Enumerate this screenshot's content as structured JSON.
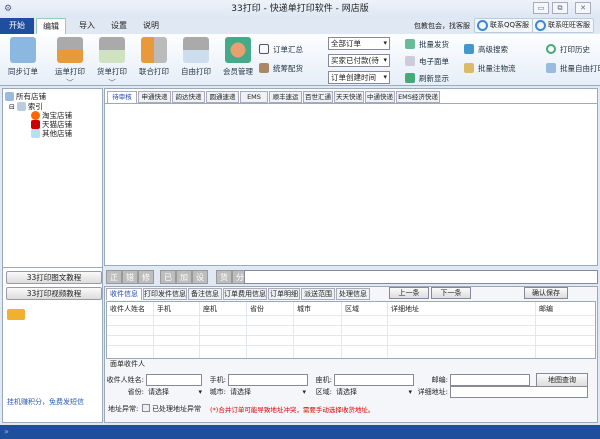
{
  "window": {
    "title": "33打印 - 快递单打印软件 - 网店版",
    "min": "▭",
    "max": "⧉",
    "close": "✕"
  },
  "menu": {
    "start": "开始",
    "tabs": [
      "编辑",
      "导入",
      "设置",
      "说明"
    ],
    "promo": "包教包会，找客服",
    "qq": "联系QQ客服",
    "wangwang": "联系旺旺客服"
  },
  "ribbon": {
    "big": [
      "同步订单",
      "运单打印",
      "货单打印",
      "联合打印",
      "自由打印",
      "会员管理"
    ],
    "small1": [
      "订单汇总",
      "统筹配货"
    ],
    "selects": [
      "全部订单",
      "买家已付款(待",
      "订单创建时间"
    ],
    "small2": [
      "批量发货",
      "电子面单",
      "刷新显示"
    ],
    "small3": [
      "高级搜索",
      "批量注物流"
    ],
    "small4": [
      "打印历史",
      "批量自由打印"
    ]
  },
  "tree": {
    "root": "所有店铺",
    "index": "索引",
    "shops": [
      "淘宝店铺",
      "天猫店铺",
      "其他店铺"
    ]
  },
  "left": {
    "tutorial_text": "33打印图文教程",
    "tutorial_video": "33打印视频教程",
    "promo_link": "挂机赚积分，免费发短信"
  },
  "courier_tabs": [
    "待审核",
    "申通快递",
    "韵达快递",
    "圆通速递",
    "EMS",
    "顺丰速运",
    "百世汇通",
    "天天快递",
    "中通快递",
    "EMS经济快递"
  ],
  "action_buttons": [
    "正",
    "错",
    "修",
    "已",
    "加",
    "设",
    "货",
    "分"
  ],
  "detail_tabs": [
    "收件信息",
    "打印发件信息",
    "备注信息",
    "订单费用信息",
    "订单明细",
    "派送范围",
    "处理信息"
  ],
  "nav": {
    "prev": "上一条",
    "next": "下一条",
    "save": "确认保存"
  },
  "table_headers": [
    "收件人姓名",
    "手机",
    "座机",
    "省份",
    "城市",
    "区域",
    "详细地址",
    "邮编"
  ],
  "form": {
    "group": "面单收件人",
    "name": "收件人姓名:",
    "mobile": "手机:",
    "phone": "座机:",
    "zip": "邮编:",
    "map": "地图查询",
    "province": "省份:",
    "city": "城市:",
    "district": "区域:",
    "address": "详细地址:",
    "choose": "请选择"
  },
  "abnormal": {
    "label": "地址异常:",
    "checkbox": "已处理地址异常",
    "warning": "(*)合并订单可能导致地址冲突，需要手动选择收货地址。"
  },
  "status": {
    "arrow": "»"
  }
}
